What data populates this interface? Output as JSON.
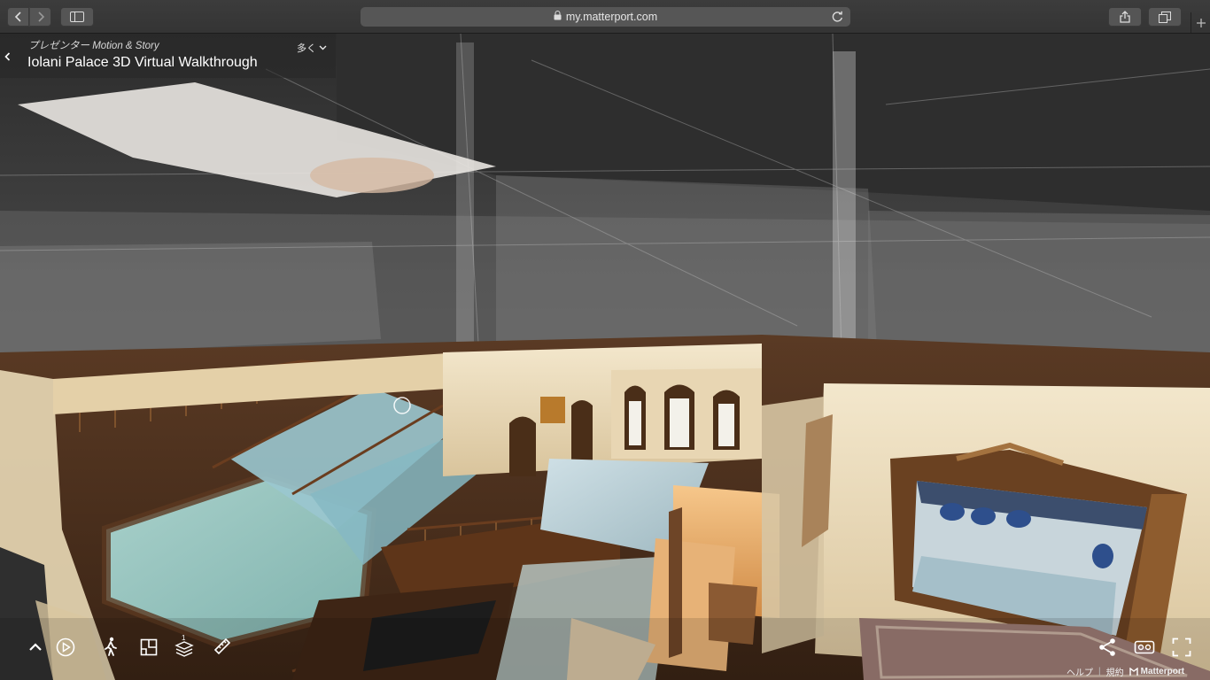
{
  "browser": {
    "url": "my.matterport.com"
  },
  "tour": {
    "presenter_prefix": "プレゼンター",
    "presenter_name": "Motion & Story",
    "title": "Iolani Palace 3D Virtual Walkthrough",
    "more_label": "多く"
  },
  "controls": {
    "floor_number": "1",
    "icons": [
      "chevron-up-icon",
      "play-icon",
      "walk-icon",
      "dollhouse-icon",
      "floors-icon",
      "measure-icon",
      "share-icon",
      "vr-icon",
      "fullscreen-icon"
    ]
  },
  "footer": {
    "help": "ヘルプ",
    "terms": "規約",
    "brand": "Matterport"
  },
  "colors": {
    "chrome": "#3c3c3c",
    "address_bar": "#565656",
    "ceiling": "#3a3a3a",
    "carpet": "#9fc6c2",
    "wood": "#6b3f22",
    "wall": "#efe2c6"
  }
}
